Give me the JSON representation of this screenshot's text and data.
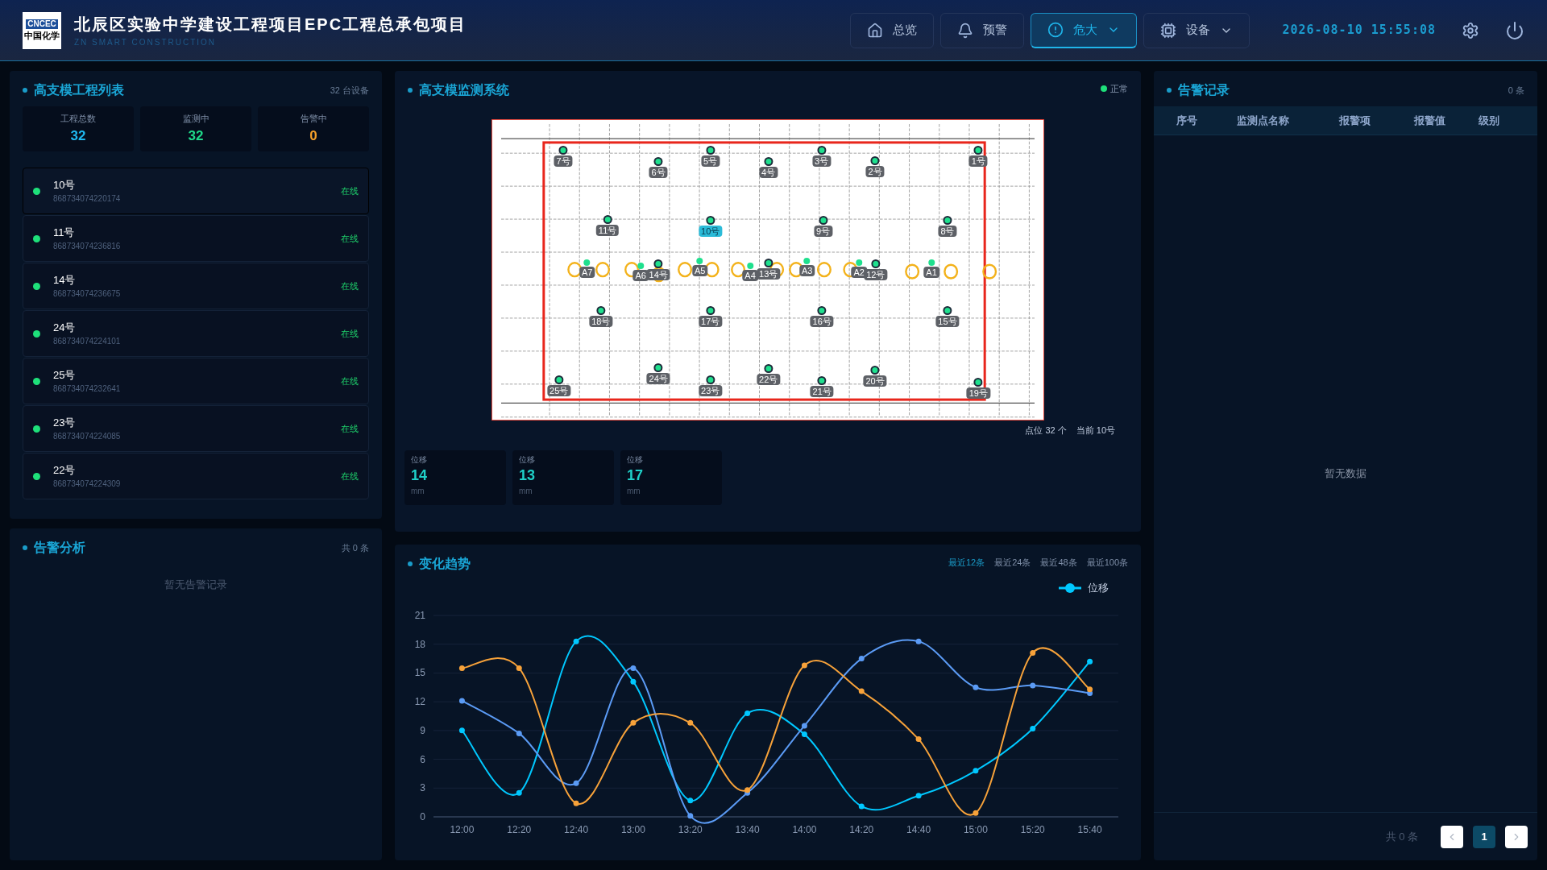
{
  "header": {
    "logo": {
      "mark": "CNCEC",
      "name": "中国化学"
    },
    "title": "北辰区实验中学建设工程项目EPC工程总承包项目",
    "subtitle": "ZN SMART CONSTRUCTION",
    "nav": [
      {
        "label": "总览",
        "kind": "home",
        "selected": false,
        "dropdown": false
      },
      {
        "label": "预警",
        "kind": "alerts",
        "selected": false,
        "dropdown": false
      },
      {
        "label": "危大",
        "kind": "hazard",
        "selected": true,
        "dropdown": true
      },
      {
        "label": "设备",
        "kind": "devices",
        "selected": false,
        "dropdown": true
      }
    ],
    "datetime": "2026-08-10 15:55:08"
  },
  "project_list": {
    "title": "高支模工程列表",
    "count": "32 台设备",
    "stats": [
      {
        "label": "工程总数",
        "value": "32",
        "color": "#1fb8f0"
      },
      {
        "label": "监测中",
        "value": "32",
        "color": "#1fd98a"
      },
      {
        "label": "告警中",
        "value": "0",
        "color": "#f5a02a"
      }
    ],
    "items": [
      {
        "name": "10号",
        "id": "868734074220174",
        "status": "在线",
        "online": true,
        "selected": true
      },
      {
        "name": "11号",
        "id": "868734074236816",
        "status": "在线",
        "online": true,
        "selected": false
      },
      {
        "name": "14号",
        "id": "868734074236675",
        "status": "在线",
        "online": true,
        "selected": false
      },
      {
        "name": "24号",
        "id": "868734074224101",
        "status": "在线",
        "online": true,
        "selected": false
      },
      {
        "name": "25号",
        "id": "868734074232641",
        "status": "在线",
        "online": true,
        "selected": false
      },
      {
        "name": "23号",
        "id": "868734074224085",
        "status": "在线",
        "online": true,
        "selected": false
      },
      {
        "name": "22号",
        "id": "868734074224309",
        "status": "在线",
        "online": true,
        "selected": false
      }
    ]
  },
  "alarm_analysis": {
    "title": "告警分析",
    "count": "共 0 条",
    "empty": "暂无告警记录"
  },
  "monitor": {
    "title": "高支模监测系统",
    "status": "正常",
    "status_ok": true,
    "points": [
      {
        "label": "7号",
        "kind": "sensor",
        "selected": false
      },
      {
        "label": "6号",
        "kind": "sensor",
        "selected": false
      },
      {
        "label": "5号",
        "kind": "sensor",
        "selected": false
      },
      {
        "label": "4号",
        "kind": "sensor",
        "selected": false
      },
      {
        "label": "3号",
        "kind": "sensor",
        "selected": false
      },
      {
        "label": "2号",
        "kind": "sensor",
        "selected": false
      },
      {
        "label": "1号",
        "kind": "sensor",
        "selected": false
      },
      {
        "label": "11号",
        "kind": "sensor",
        "selected": false
      },
      {
        "label": "10号",
        "kind": "sensor",
        "selected": true
      },
      {
        "label": "9号",
        "kind": "sensor",
        "selected": false
      },
      {
        "label": "8号",
        "kind": "sensor",
        "selected": false
      },
      {
        "label": "A7",
        "kind": "anchor",
        "selected": false
      },
      {
        "label": "A6",
        "kind": "anchor",
        "selected": false
      },
      {
        "label": "14号",
        "kind": "sensor",
        "selected": false
      },
      {
        "label": "A5",
        "kind": "anchor",
        "selected": false
      },
      {
        "label": "A4",
        "kind": "anchor",
        "selected": false
      },
      {
        "label": "13号",
        "kind": "sensor",
        "selected": false
      },
      {
        "label": "A3",
        "kind": "anchor",
        "selected": false
      },
      {
        "label": "A2",
        "kind": "anchor",
        "selected": false
      },
      {
        "label": "12号",
        "kind": "sensor",
        "selected": false
      },
      {
        "label": "A1",
        "kind": "anchor",
        "selected": false
      },
      {
        "label": "18号",
        "kind": "sensor",
        "selected": false
      },
      {
        "label": "17号",
        "kind": "sensor",
        "selected": false
      },
      {
        "label": "16号",
        "kind": "sensor",
        "selected": false
      },
      {
        "label": "15号",
        "kind": "sensor",
        "selected": false
      },
      {
        "label": "24号",
        "kind": "sensor",
        "selected": false
      },
      {
        "label": "22号",
        "kind": "sensor",
        "selected": false
      },
      {
        "label": "20号",
        "kind": "sensor",
        "selected": false
      },
      {
        "label": "25号",
        "kind": "sensor",
        "selected": false
      },
      {
        "label": "23号",
        "kind": "sensor",
        "selected": false
      },
      {
        "label": "21号",
        "kind": "sensor",
        "selected": false
      },
      {
        "label": "19号",
        "kind": "sensor",
        "selected": false
      }
    ],
    "caption_count": "点位 32 个",
    "caption_current": "当前 10号",
    "readings": [
      {
        "label": "位移",
        "value": "14",
        "unit": "mm"
      },
      {
        "label": "位移",
        "value": "13",
        "unit": "mm"
      },
      {
        "label": "位移",
        "value": "17",
        "unit": "mm"
      }
    ]
  },
  "trend": {
    "title": "变化趋势",
    "ranges": [
      {
        "label": "最近12条",
        "selected": true
      },
      {
        "label": "最近24条",
        "selected": false
      },
      {
        "label": "最近48条",
        "selected": false
      },
      {
        "label": "最近100条",
        "selected": false
      }
    ],
    "chart_data": {
      "type": "line",
      "grid": true,
      "categories": [
        "12:00",
        "12:20",
        "12:40",
        "13:00",
        "13:20",
        "13:40",
        "14:00",
        "14:20",
        "14:40",
        "15:00",
        "15:20",
        "15:40"
      ],
      "ylim": [
        0,
        21
      ],
      "yticks": [
        0,
        3,
        6,
        9,
        12,
        15,
        18,
        21
      ],
      "series": [
        {
          "name": "位移",
          "color": "#00c8ff",
          "marker": true,
          "values": [
            9,
            2.5,
            18.3,
            14.1,
            1.7,
            10.8,
            8.6,
            1.1,
            2.2,
            4.8,
            9.2,
            16.2
          ]
        },
        {
          "color": "#5b9bf5",
          "marker": true,
          "values": [
            12.1,
            8.7,
            3.5,
            15.5,
            0.1,
            2.5,
            9.5,
            16.5,
            18.3,
            13.5,
            13.7,
            12.9
          ]
        },
        {
          "color": "#f7a23a",
          "marker": true,
          "values": [
            15.5,
            15.5,
            1.4,
            9.8,
            9.8,
            2.8,
            15.8,
            13.1,
            8.1,
            0.4,
            17.1,
            13.3
          ]
        }
      ]
    }
  },
  "alarm_records": {
    "title": "告警记录",
    "count": "0 条",
    "columns": [
      "序号",
      "监测点名称",
      "报警项",
      "报警值",
      "级别"
    ],
    "empty": "暂无数据",
    "total": "共 0 条",
    "pages": [
      {
        "label": "1",
        "selected": true
      }
    ]
  }
}
